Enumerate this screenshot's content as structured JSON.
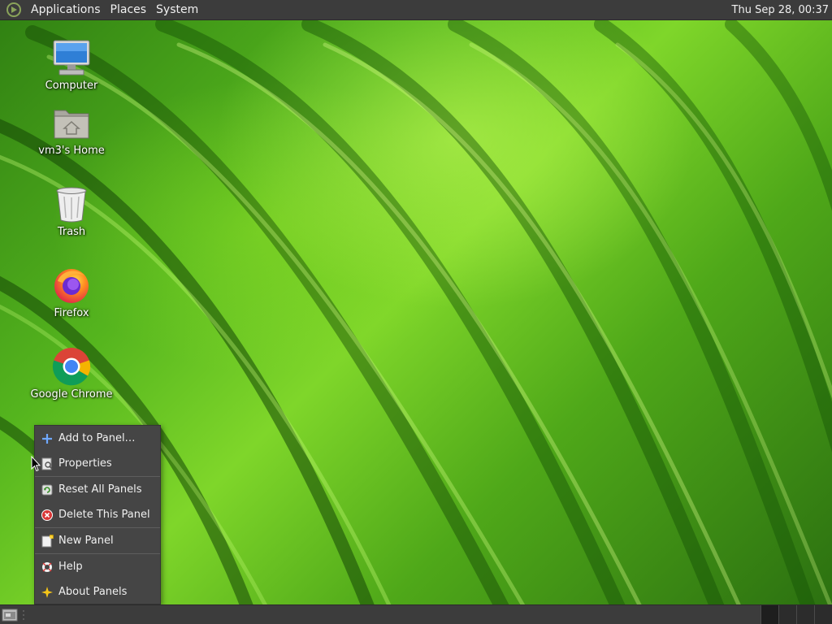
{
  "top_panel": {
    "menus": [
      "Applications",
      "Places",
      "System"
    ],
    "clock": "Thu Sep 28, 00:37"
  },
  "desktop_icons": [
    {
      "label": "Computer",
      "icon": "computer-icon"
    },
    {
      "label": "vm3's Home",
      "icon": "home-folder-icon"
    },
    {
      "label": "Trash",
      "icon": "trash-icon"
    },
    {
      "label": "Firefox",
      "icon": "firefox-icon"
    },
    {
      "label": "Google Chrome",
      "icon": "chrome-icon"
    }
  ],
  "context_menu": {
    "items": [
      {
        "label": "Add to Panel…",
        "icon": "add-icon"
      },
      {
        "label": "Properties",
        "icon": "properties-icon"
      },
      {
        "label": "Reset All Panels",
        "icon": "reset-icon"
      },
      {
        "label": "Delete This Panel",
        "icon": "delete-icon"
      },
      {
        "label": "New Panel",
        "icon": "new-panel-icon"
      },
      {
        "label": "Help",
        "icon": "help-icon"
      },
      {
        "label": "About Panels",
        "icon": "about-icon"
      }
    ]
  },
  "colors": {
    "panel_bg": "#3c3c3c",
    "menu_bg": "#454545",
    "desktop_green": "#5ab51f"
  }
}
